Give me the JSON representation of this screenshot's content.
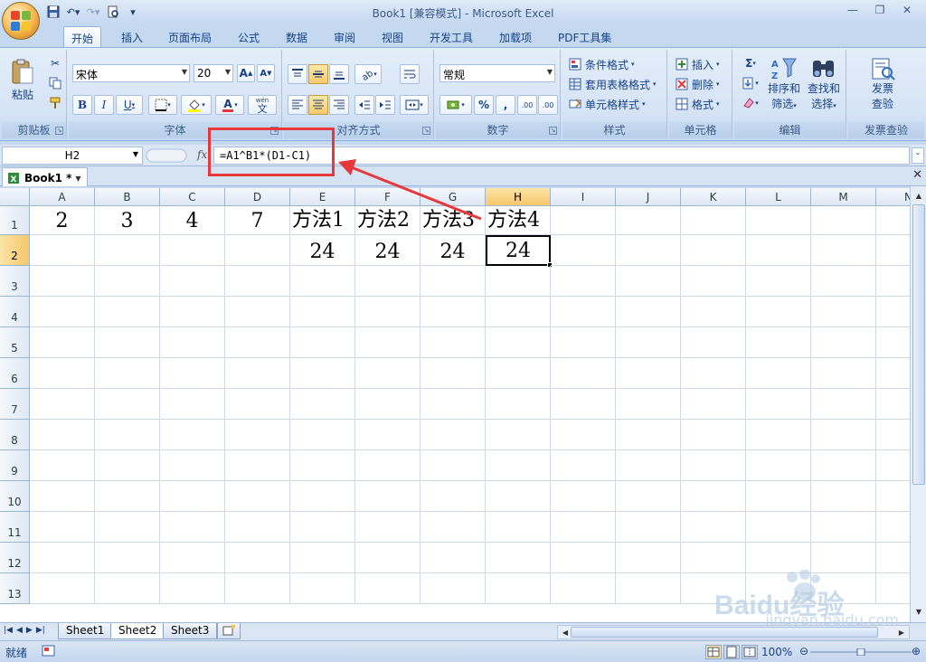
{
  "window": {
    "title": "Book1  [兼容模式] - Microsoft Excel",
    "controls": {
      "minimize": "—",
      "restore": "❐",
      "close": "✕"
    }
  },
  "ribbon_tabs": [
    "开始",
    "插入",
    "页面布局",
    "公式",
    "数据",
    "审阅",
    "视图",
    "开发工具",
    "加载项",
    "PDF工具集"
  ],
  "active_tab": "开始",
  "ribbon": {
    "clipboard": {
      "label": "剪贴板",
      "paste": "粘贴"
    },
    "font": {
      "label": "字体",
      "name": "宋体",
      "size": "20",
      "bold": "B",
      "italic": "I",
      "underline": "U",
      "grow": "A",
      "shrink": "A",
      "phonetic": "wén",
      "phonetic_char": "文"
    },
    "alignment": {
      "label": "对齐方式"
    },
    "number": {
      "label": "数字",
      "format": "常规",
      "percent": "%",
      "comma": ",",
      "inc_decimal": ".00",
      "dec_decimal": ".00"
    },
    "styles": {
      "label": "样式",
      "cond_format": "条件格式",
      "table_format": "套用表格格式",
      "cell_style": "单元格样式"
    },
    "cells": {
      "label": "单元格",
      "insert": "插入",
      "delete": "删除",
      "format": "格式"
    },
    "editing": {
      "label": "编辑",
      "sum": "Σ",
      "sort_filter_1": "排序和",
      "sort_filter_2": "筛选",
      "find_select_1": "查找和",
      "find_select_2": "选择"
    },
    "invoice": {
      "label": "发票查验",
      "btn_1": "发票",
      "btn_2": "查验"
    }
  },
  "formula_bar": {
    "name_box": "H2",
    "fx": "fx",
    "formula": "=A1^B1*(D1-C1)"
  },
  "workbook_tab": "Book1 *",
  "columns": [
    "A",
    "B",
    "C",
    "D",
    "E",
    "F",
    "G",
    "H",
    "I",
    "J",
    "K",
    "L",
    "M",
    "N"
  ],
  "rows": [
    "1",
    "2",
    "3",
    "4",
    "5",
    "6",
    "7",
    "8",
    "9",
    "10",
    "11",
    "12",
    "13"
  ],
  "cells": {
    "A1": "2",
    "B1": "3",
    "C1": "4",
    "D1": "7",
    "E1": "方法1",
    "F1": "方法2",
    "G1": "方法3",
    "H1": "方法4",
    "E2": "24",
    "F2": "24",
    "G2": "24",
    "H2": "24"
  },
  "selected_cell": "H2",
  "sheets": [
    "Sheet1",
    "Sheet2",
    "Sheet3"
  ],
  "active_sheet": "Sheet2",
  "status": {
    "mode": "就绪",
    "zoom": "100%"
  },
  "watermark": {
    "brand": "Baidu经验",
    "url": "jingyan.baidu.com"
  },
  "colors": {
    "annotation": "#e8383b",
    "ribbon_bg": "#d5e3f5",
    "header_active": "#f7c76b"
  }
}
